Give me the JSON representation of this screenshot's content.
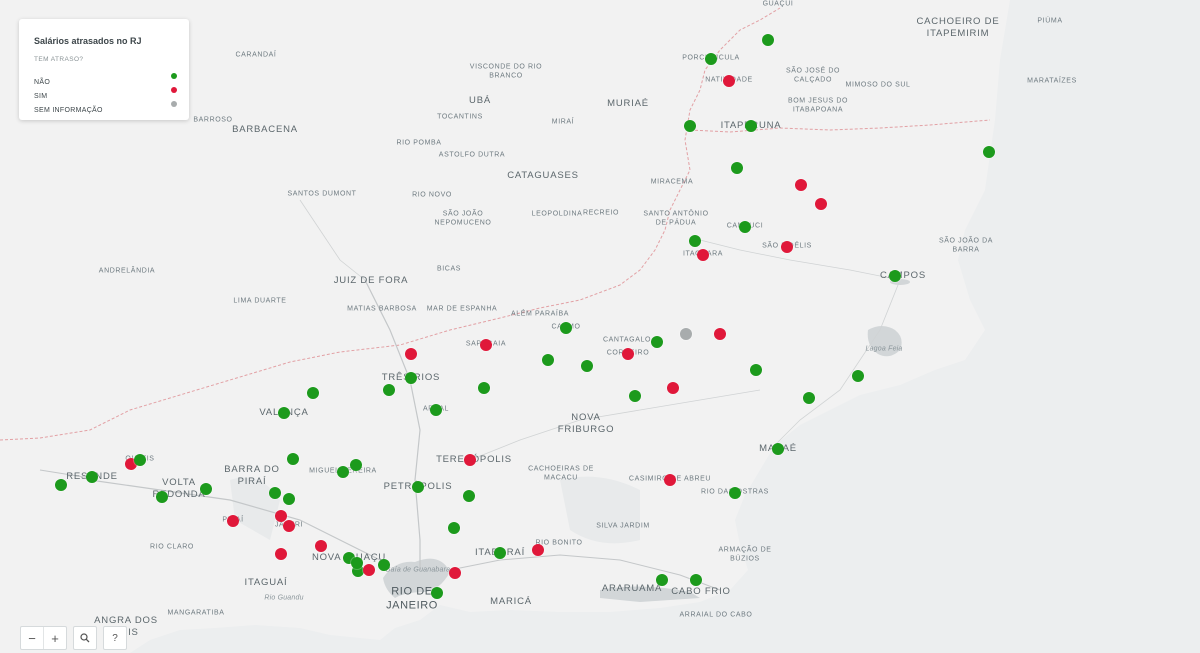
{
  "legend": {
    "title": "Salários atrasados no RJ",
    "subtitle": "TEM ATRASO?",
    "items": [
      {
        "label": "NÃO",
        "color": "#1c9a1c"
      },
      {
        "label": "SIM",
        "color": "#e0183a"
      },
      {
        "label": "SEM INFORMAÇÃO",
        "color": "#a8acad"
      }
    ]
  },
  "colors": {
    "land": "#f2f2f2",
    "water": "#d2d6d8",
    "border": "#e2a0a4",
    "road": "#c4c7c9",
    "nao": "#1c9a1c",
    "sim": "#e0183a",
    "sem_info": "#a8acad"
  },
  "controls": {
    "zoom_out": "−",
    "zoom_in": "+",
    "search_icon": "magnifier-icon",
    "help": "?"
  },
  "places": [
    {
      "name": "GUAÇUÍ"
    },
    {
      "name": "CACHOEIRO DE\nITAPEMIRIM",
      "cls": "big"
    },
    {
      "name": "PIÚMA"
    },
    {
      "name": "CARANDAÍ"
    },
    {
      "name": "PORCIÚNCULA"
    },
    {
      "name": "SÃO JOSÉ DO\nCALÇADO"
    },
    {
      "name": "MIMOSO DO SUL"
    },
    {
      "name": "MARATAÍZES"
    },
    {
      "name": "VISCONDE DO RIO\nBRANCO"
    },
    {
      "name": "NATIVIDADE"
    },
    {
      "name": "BOM JESUS DO\nITABAPOANA"
    },
    {
      "name": "UBÁ",
      "cls": "big"
    },
    {
      "name": "MURIAÉ",
      "cls": "big"
    },
    {
      "name": "BARROSO"
    },
    {
      "name": "TOCANTINS"
    },
    {
      "name": "MIRAÍ"
    },
    {
      "name": "ITAPERUNA",
      "cls": "big"
    },
    {
      "name": "BARBACENA",
      "cls": "big"
    },
    {
      "name": "RIO POMBA"
    },
    {
      "name": "ASTOLFO DUTRA"
    },
    {
      "name": "CATAGUASES",
      "cls": "big"
    },
    {
      "name": "MIRACEMA"
    },
    {
      "name": "SANTOS DUMONT"
    },
    {
      "name": "RIO NOVO"
    },
    {
      "name": "LEOPOLDINA"
    },
    {
      "name": "RECREIO"
    },
    {
      "name": "SANTO ANTÔNIO\nDE PÁDUA"
    },
    {
      "name": "SÃO JOÃO\nNEPOMUCENO"
    },
    {
      "name": "CAMBUCI"
    },
    {
      "name": "SÃO JOÃO DA\nBARRA"
    },
    {
      "name": "SÃO FIDÉLIS"
    },
    {
      "name": "ITAOCARA"
    },
    {
      "name": "ANDRELÂNDIA"
    },
    {
      "name": "BICAS"
    },
    {
      "name": "JUIZ DE FORA",
      "cls": "big"
    },
    {
      "name": "CAMPOS",
      "cls": "big"
    },
    {
      "name": "LIMA DUARTE"
    },
    {
      "name": "MATIAS BARBOSA"
    },
    {
      "name": "MAR DE ESPANHA"
    },
    {
      "name": "ALÉM PARAÍBA"
    },
    {
      "name": "CARMO"
    },
    {
      "name": "CANTAGALO"
    },
    {
      "name": "SAPUCAIA"
    },
    {
      "name": "CORDEIRO"
    },
    {
      "name": "Lagoa Feia",
      "cls": "water"
    },
    {
      "name": "TRÊS RIOS",
      "cls": "big"
    },
    {
      "name": "AREAL"
    },
    {
      "name": "VALENÇA",
      "cls": "big"
    },
    {
      "name": "NOVA\nFRIBURGO",
      "cls": "big"
    },
    {
      "name": "MACAÉ",
      "cls": "big"
    },
    {
      "name": "QUATIS"
    },
    {
      "name": "TERESÓPOLIS",
      "cls": "big"
    },
    {
      "name": "BARRA DO\nPIRAÍ",
      "cls": "big"
    },
    {
      "name": "CACHOEIRAS DE\nMACACU"
    },
    {
      "name": "RESENDE",
      "cls": "big"
    },
    {
      "name": "MIGUEL PEREIRA"
    },
    {
      "name": "VOLTA\nREDONDA",
      "cls": "big"
    },
    {
      "name": "CASIMIRO DE ABREU"
    },
    {
      "name": "PETRÓPOLIS",
      "cls": "big"
    },
    {
      "name": "RIO DAS OSTRAS"
    },
    {
      "name": "PIRAÍ"
    },
    {
      "name": "JAPERI"
    },
    {
      "name": "SILVA JARDIM"
    },
    {
      "name": "RIO CLARO"
    },
    {
      "name": "NOVA IGUAÇU",
      "cls": "big"
    },
    {
      "name": "ITABORAÍ",
      "cls": "big"
    },
    {
      "name": "RIO BONITO"
    },
    {
      "name": "ARMAÇÃO DE\nBÚZIOS"
    },
    {
      "name": "Baía de Guanabara",
      "cls": "water"
    },
    {
      "name": "ITAGUAÍ",
      "cls": "big"
    },
    {
      "name": "Rio Guandu",
      "cls": "water"
    },
    {
      "name": "ARARUAMA",
      "cls": "big"
    },
    {
      "name": "RIO DE\nJANEIRO",
      "cls": "huge"
    },
    {
      "name": "CABO FRIO",
      "cls": "big"
    },
    {
      "name": "MARICÁ",
      "cls": "big"
    },
    {
      "name": "MANGARATIBA"
    },
    {
      "name": "ARRAIAL DO CABO"
    },
    {
      "name": "ANGRA DOS\nREIS",
      "cls": "big"
    }
  ],
  "points": [
    {
      "status": "nao"
    },
    {
      "status": "nao"
    },
    {
      "status": "sim"
    },
    {
      "status": "nao"
    },
    {
      "status": "nao"
    },
    {
      "status": "nao"
    },
    {
      "status": "sim"
    },
    {
      "status": "sim"
    },
    {
      "status": "nao"
    },
    {
      "status": "nao"
    },
    {
      "status": "nao"
    },
    {
      "status": "sim"
    },
    {
      "status": "sim"
    },
    {
      "status": "nao"
    },
    {
      "status": "nao"
    },
    {
      "status": "sem_info"
    },
    {
      "status": "sim"
    },
    {
      "status": "nao"
    },
    {
      "status": "sim"
    },
    {
      "status": "sim"
    },
    {
      "status": "nao"
    },
    {
      "status": "nao"
    },
    {
      "status": "nao"
    },
    {
      "status": "nao"
    },
    {
      "status": "nao"
    },
    {
      "status": "nao"
    },
    {
      "status": "sim"
    },
    {
      "status": "nao"
    },
    {
      "status": "nao"
    },
    {
      "status": "nao"
    },
    {
      "status": "nao"
    },
    {
      "status": "nao"
    },
    {
      "status": "sim"
    },
    {
      "status": "nao"
    },
    {
      "status": "sim"
    },
    {
      "status": "nao"
    },
    {
      "status": "nao"
    },
    {
      "status": "nao"
    },
    {
      "status": "nao"
    },
    {
      "status": "nao"
    },
    {
      "status": "nao"
    },
    {
      "status": "nao"
    },
    {
      "status": "nao"
    },
    {
      "status": "nao"
    },
    {
      "status": "nao"
    },
    {
      "status": "sim"
    },
    {
      "status": "nao"
    },
    {
      "status": "nao"
    },
    {
      "status": "nao"
    },
    {
      "status": "sim"
    },
    {
      "status": "sim"
    },
    {
      "status": "sim"
    },
    {
      "status": "sim"
    },
    {
      "status": "sim"
    },
    {
      "status": "nao"
    },
    {
      "status": "nao"
    },
    {
      "status": "sim"
    },
    {
      "status": "nao"
    },
    {
      "status": "nao"
    },
    {
      "status": "sim"
    },
    {
      "status": "nao"
    },
    {
      "status": "nao"
    },
    {
      "status": "sim"
    },
    {
      "status": "nao"
    },
    {
      "status": "nao"
    },
    {
      "status": "nao"
    },
    {
      "status": "sim"
    },
    {
      "status": "nao"
    }
  ]
}
